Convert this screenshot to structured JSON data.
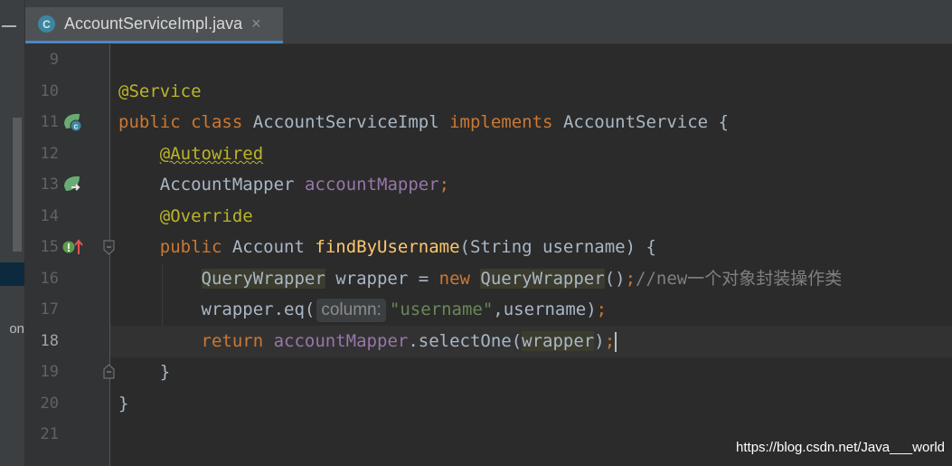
{
  "tab": {
    "icon_letter": "C",
    "filename": "AccountServiceImpl.java",
    "close_glyph": "×"
  },
  "left_panel": {
    "cut_text": "on"
  },
  "lines": [
    {
      "number": "9"
    },
    {
      "number": "10"
    },
    {
      "number": "11"
    },
    {
      "number": "12"
    },
    {
      "number": "13"
    },
    {
      "number": "14"
    },
    {
      "number": "15"
    },
    {
      "number": "16"
    },
    {
      "number": "17"
    },
    {
      "number": "18"
    },
    {
      "number": "19"
    },
    {
      "number": "20"
    },
    {
      "number": "21"
    }
  ],
  "code": {
    "l10_annotation": "@Service",
    "l11_public": "public",
    "l11_class": "class",
    "l11_name": "AccountServiceImpl",
    "l11_implements": "implements",
    "l11_iface": "AccountService",
    "l11_brace": "{",
    "l12_annotation": "@Autowired",
    "l13_type": "AccountMapper",
    "l13_field": "accountMapper",
    "l13_semi": ";",
    "l14_annotation": "@Override",
    "l15_public": "public",
    "l15_type": "Account",
    "l15_method": "findByUsername",
    "l15_params": "(String username) {",
    "l16_type": "QueryWrapper",
    "l16_var": " wrapper = ",
    "l16_new": "new",
    "l16_ctor": "QueryWrapper",
    "l16_parens": "()",
    "l16_semi": ";",
    "l16_comment": "//new一个对象封装操作类",
    "l17_call": "wrapper.eq(",
    "l17_hint": "column:",
    "l17_str": "\"username\"",
    "l17_rest": ",username)",
    "l17_semi": ";",
    "l18_return": "return",
    "l18_field": "accountMapper",
    "l18_call": ".selectOne(",
    "l18_arg": "wrapper",
    "l18_close": ")",
    "l18_semi": ";",
    "l19_brace": "}",
    "l20_brace": "}"
  },
  "watermark": "https://blog.csdn.net/Java___world",
  "colors": {
    "editor_bg": "#2b2b2b",
    "keyword": "#cc7832",
    "annotation": "#bbb529",
    "field": "#9876aa",
    "method": "#ffc66d",
    "string": "#6a8759",
    "comment": "#808080",
    "text": "#a9b7c6",
    "tab_accent": "#4a88c7"
  },
  "icons": [
    "collapse-icon",
    "class-icon",
    "close-icon",
    "spring-bean-implements-icon",
    "spring-autowired-icon",
    "override-icon",
    "fold-icon",
    "intention-bulb-icon"
  ]
}
